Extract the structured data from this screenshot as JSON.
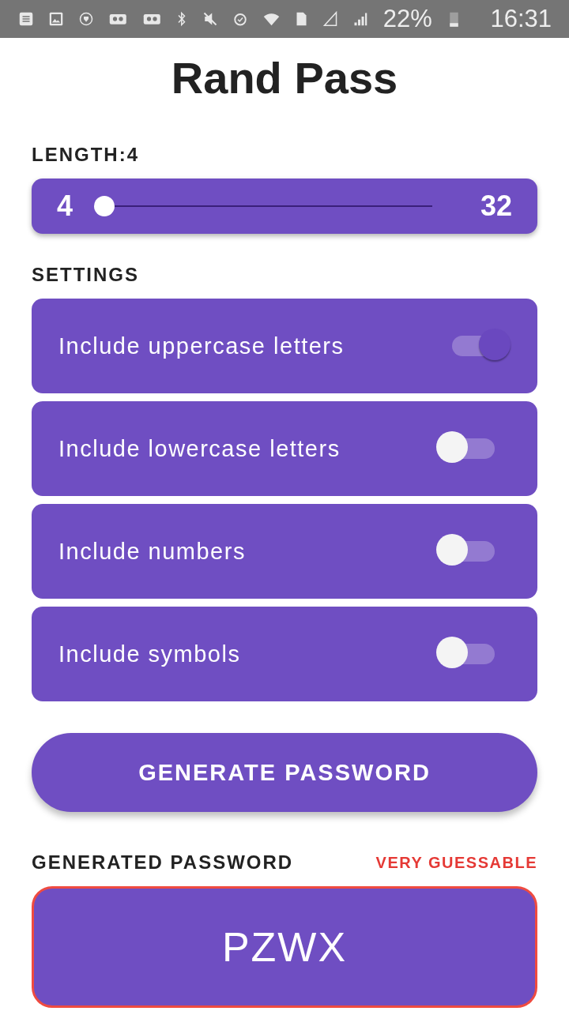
{
  "status_bar": {
    "battery": "22%",
    "time": "16:31"
  },
  "title": "Rand Pass",
  "length": {
    "label": "LENGTH:4",
    "min": "4",
    "max": "32",
    "level": 0
  },
  "settings": {
    "heading": "SETTINGS",
    "options": [
      {
        "label": "Include uppercase letters",
        "on": true
      },
      {
        "label": "Include lowercase letters",
        "on": false
      },
      {
        "label": "Include numbers",
        "on": false
      },
      {
        "label": "Include symbols",
        "on": false
      }
    ]
  },
  "generate_button": "GENERATE PASSWORD",
  "result": {
    "heading": "GENERATED PASSWORD",
    "strength": "VERY GUESSABLE",
    "password": "PZWX"
  }
}
